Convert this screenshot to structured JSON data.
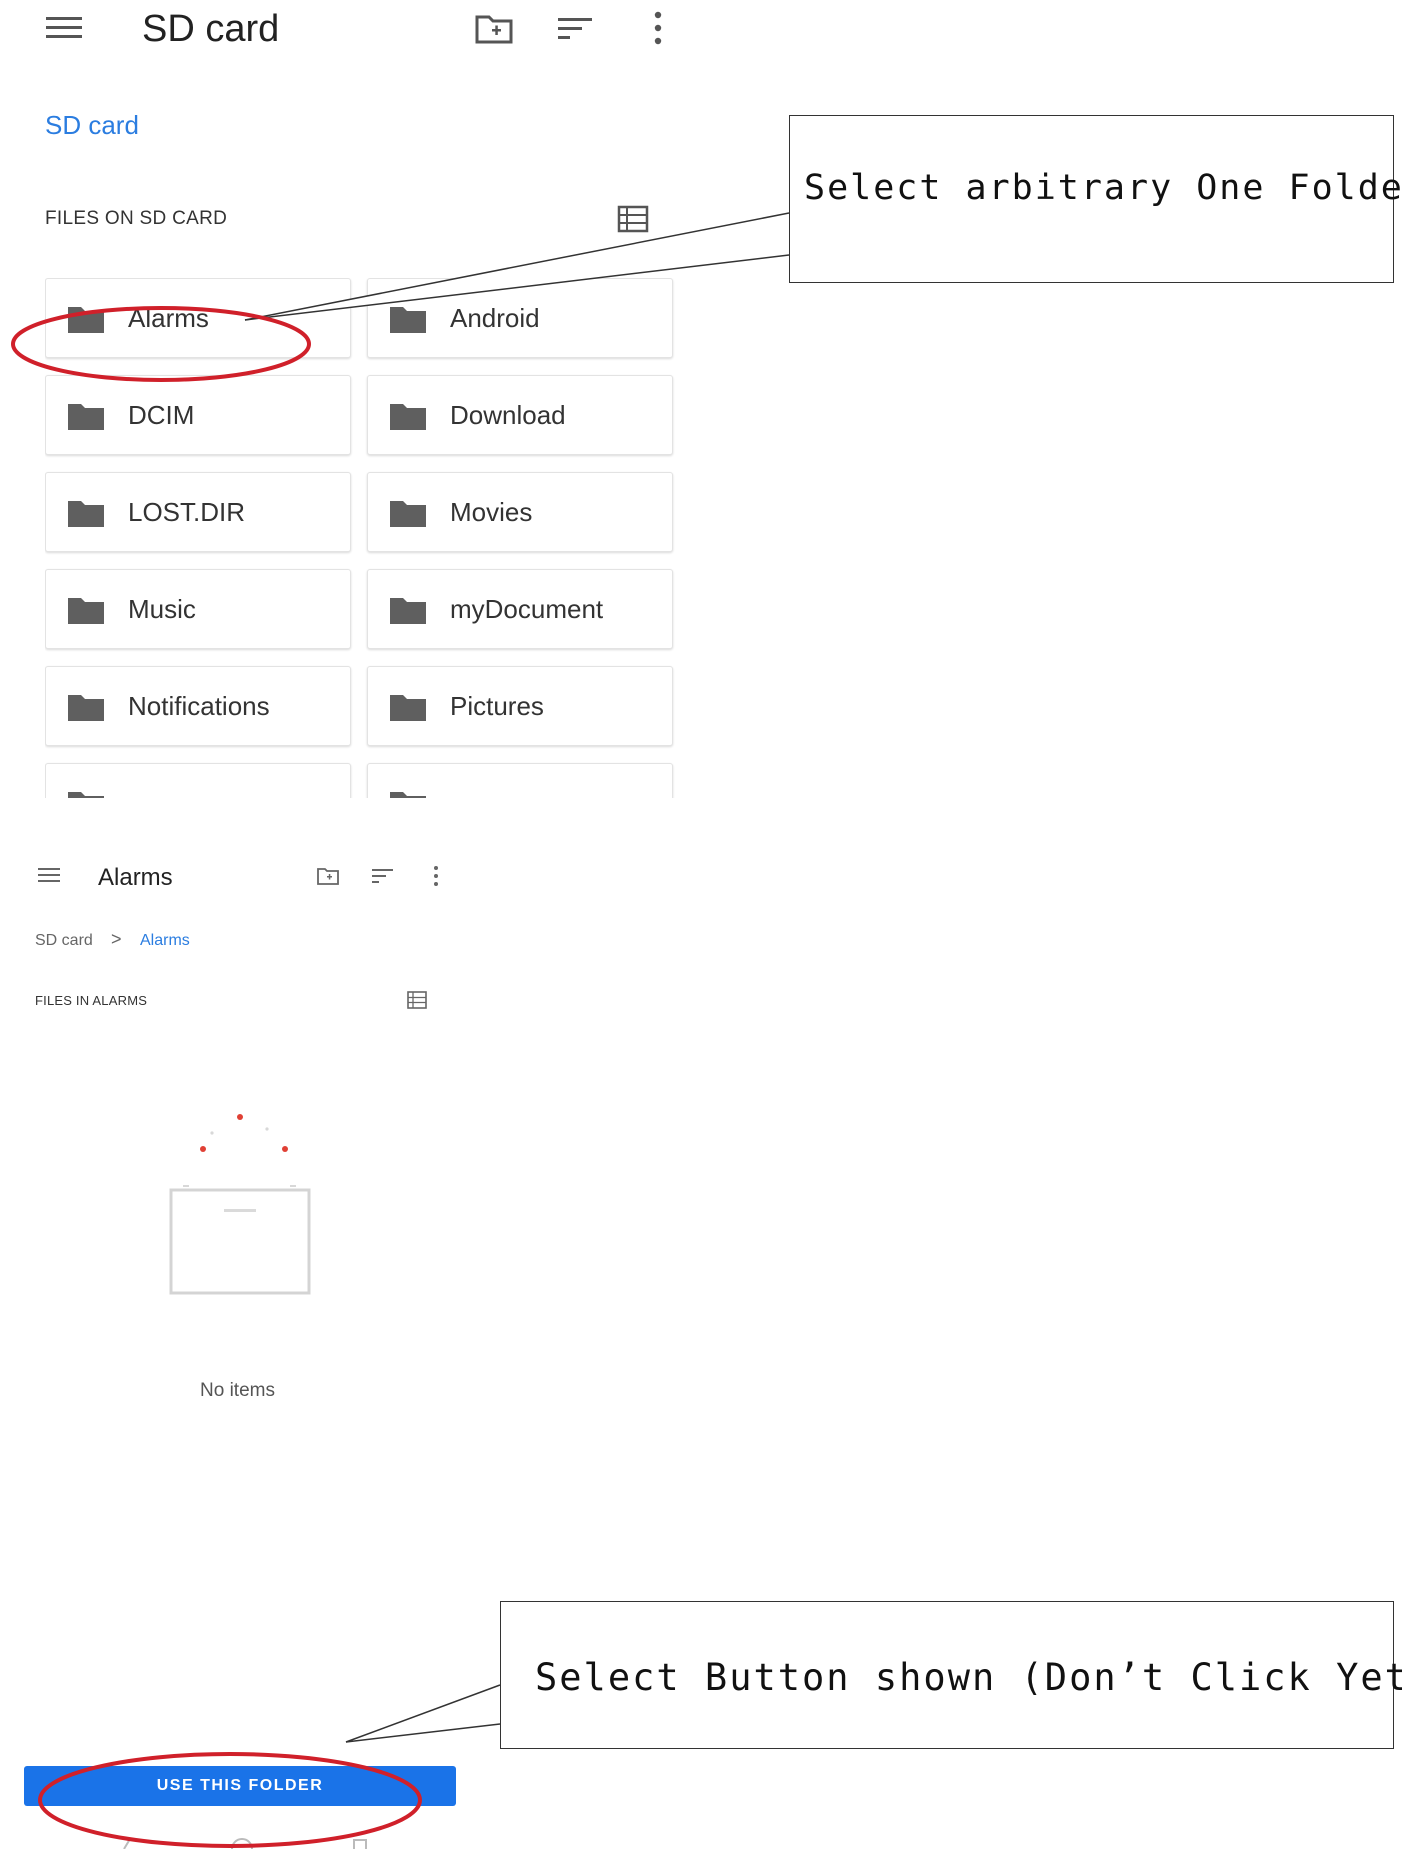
{
  "screen1": {
    "title": "SD card",
    "root_label": "SD card",
    "section_header": "FILES ON SD CARD",
    "icons": {
      "menu": "hamburger-menu-icon",
      "new_folder": "new-folder-icon",
      "sort": "sort-icon",
      "more": "more-vert-icon",
      "list_view": "list-view-icon"
    },
    "folders": [
      "Alarms",
      "Android",
      "DCIM",
      "Download",
      "LOST.DIR",
      "Movies",
      "Music",
      "myDocument",
      "Notifications",
      "Pictures"
    ]
  },
  "screen2": {
    "title": "Alarms",
    "breadcrumb": {
      "root": "SD card",
      "separator": ">",
      "current": "Alarms"
    },
    "section_header": "FILES IN ALARMS",
    "empty_text": "No items",
    "use_button": "USE THIS FOLDER"
  },
  "annotations": {
    "callout1": "Select arbitrary One Folder",
    "callout2": "Select Button shown (Don’t Click Yet)",
    "highlight_color": "#d0202a"
  },
  "colors": {
    "accent": "#1a73e8",
    "link": "#2b7de0",
    "folder_icon": "#5f5f5f"
  }
}
